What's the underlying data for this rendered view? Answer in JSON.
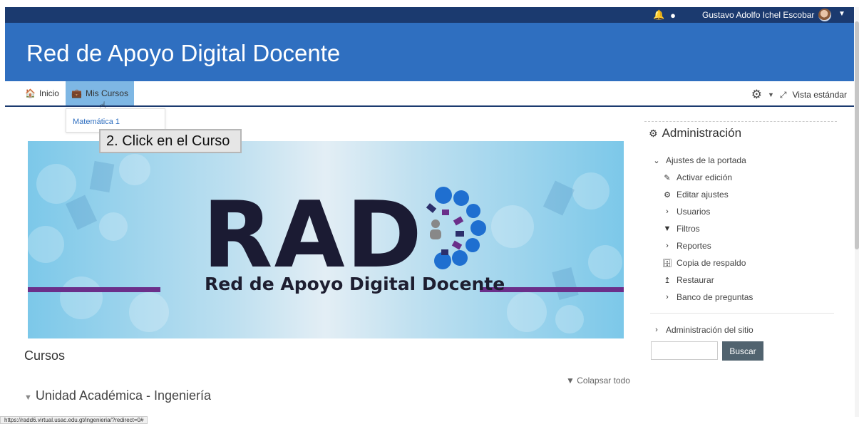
{
  "topbar": {
    "user_name": "Gustavo Adolfo Ichel Escobar",
    "bell_icon": "bell-icon",
    "chat_icon": "chat-icon"
  },
  "header": {
    "site_title": "Red de Apoyo Digital Docente"
  },
  "nav": {
    "home_label": "Inicio",
    "courses_label": "Mis Cursos",
    "view_label": "Vista estándar"
  },
  "dropdown": {
    "course_item": "Matemática 1"
  },
  "annotation": {
    "text": "2. Click en el Curso"
  },
  "banner": {
    "logo_text": "RAD",
    "subtitle": "Red de Apoyo Digital Docente",
    "colors": {
      "purple": "#6b2f8a",
      "navy": "#2c2f6b",
      "blue": "#1f6fd0"
    }
  },
  "main": {
    "section_title": "Cursos",
    "collapse_label": "Colapsar todo",
    "category_label": "Unidad Académica - Ingeniería"
  },
  "sidebar": {
    "title": "Administración",
    "items": [
      {
        "label": "Ajustes de la portada",
        "icon": "chevron-down-icon",
        "level": 1
      },
      {
        "label": "Activar edición",
        "icon": "pencil-icon",
        "level": 2
      },
      {
        "label": "Editar ajustes",
        "icon": "gear-icon",
        "level": 2
      },
      {
        "label": "Usuarios",
        "icon": "chevron-right-icon",
        "level": 2
      },
      {
        "label": "Filtros",
        "icon": "filter-icon",
        "level": 2
      },
      {
        "label": "Reportes",
        "icon": "chevron-right-icon",
        "level": 2
      },
      {
        "label": "Copia de respaldo",
        "icon": "backup-icon",
        "level": 2
      },
      {
        "label": "Restaurar",
        "icon": "restore-icon",
        "level": 2
      },
      {
        "label": "Banco de preguntas",
        "icon": "chevron-right-icon",
        "level": 2
      }
    ],
    "site_admin_label": "Administración del sitio",
    "search_button": "Buscar",
    "search_value": ""
  },
  "status_url": "https://radd6.virtual.usac.edu.gt/ingenieria/?redirect=0#"
}
